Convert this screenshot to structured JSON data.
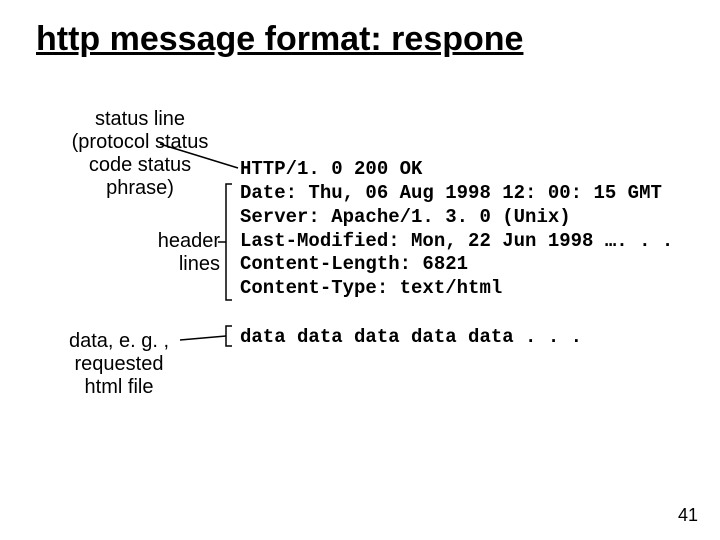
{
  "title": "http message format: respone",
  "labels": {
    "status": "status line\n(protocol\nstatus code\nstatus phrase)",
    "headers": "header\nlines",
    "data": "data, e. g. ,\nrequested\nhtml file"
  },
  "response": {
    "status_line": "HTTP/1. 0 200 OK",
    "header_lines": "Date: Thu, 06 Aug 1998 12: 00: 15 GMT\nServer: Apache/1. 3. 0 (Unix)\nLast-Modified: Mon, 22 Jun 1998 …. . .\nContent-Length: 6821\nContent-Type: text/html",
    "data_line": "data data data data data . . ."
  },
  "page_number": "41"
}
